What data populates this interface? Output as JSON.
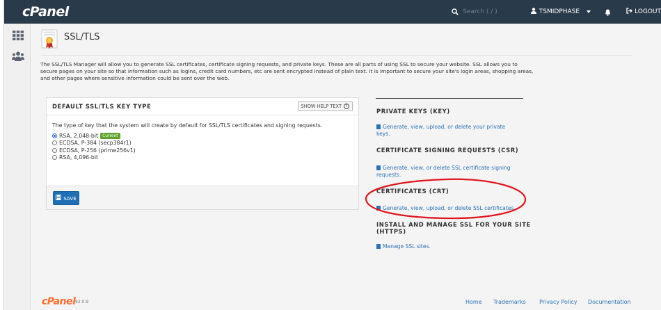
{
  "app": {
    "logo": "cPanel"
  },
  "topbar": {
    "search_label": "Search ( / )",
    "user": "TSMIDPHASE",
    "logout": "LOGOUT",
    "icons": [
      "search-icon",
      "user-icon",
      "caret-down-icon",
      "bell-icon",
      "logout-icon"
    ]
  },
  "rail": {
    "icons": [
      "grid-icon",
      "users-icon"
    ]
  },
  "page": {
    "title": "SSL/TLS",
    "intro": "The SSL/TLS Manager will allow you to generate SSL certificates, certificate signing requests, and private keys. These are all parts of using SSL to secure your website. SSL allows you to secure pages on your site so that information such as logins, credit card numbers, etc are sent encrypted instead of plain text. It is important to secure your site's login areas, shopping areas, and other pages where sensitive information could be sent over the web."
  },
  "key_type": {
    "title": "DEFAULT SSL/TLS KEY TYPE",
    "help_button": "SHOW HELP TEXT",
    "description": "The type of key that the system will create by default for SSL/TLS certificates and signing requests.",
    "options": [
      {
        "label": "RSA, 2,048-bit",
        "checked": true,
        "badge": "Current"
      },
      {
        "label": "ECDSA, P-384 (secp384r1)",
        "checked": false
      },
      {
        "label": "ECDSA, P-256 (prime256v1)",
        "checked": false
      },
      {
        "label": "RSA, 4,096-bit",
        "checked": false
      }
    ],
    "save_label": "SAVE"
  },
  "sections": [
    {
      "title": "PRIVATE KEYS (KEY)",
      "link": "Generate, view, upload, or delete your private keys."
    },
    {
      "title": "CERTIFICATE SIGNING REQUESTS (CSR)",
      "link": "Generate, view, or delete SSL certificate signing requests."
    },
    {
      "title": "CERTIFICATES (CRT)",
      "link": "Generate, view, upload, or delete SSL certificates."
    },
    {
      "title": "INSTALL AND MANAGE SSL FOR YOUR SITE (HTTPS)",
      "link": "Manage SSL sites."
    }
  ],
  "annotation": {
    "color": "#e0161e"
  },
  "footer": {
    "logo": "cPanel",
    "version": "92.0.9",
    "links": [
      "Home",
      "Trademarks",
      "Privacy Policy",
      "Documentation"
    ]
  },
  "colors": {
    "topbar": "#293a4a",
    "link": "#2a72b5",
    "primary": "#1f6fb5",
    "badge": "#5da22b",
    "brand": "#ff6c2c"
  }
}
